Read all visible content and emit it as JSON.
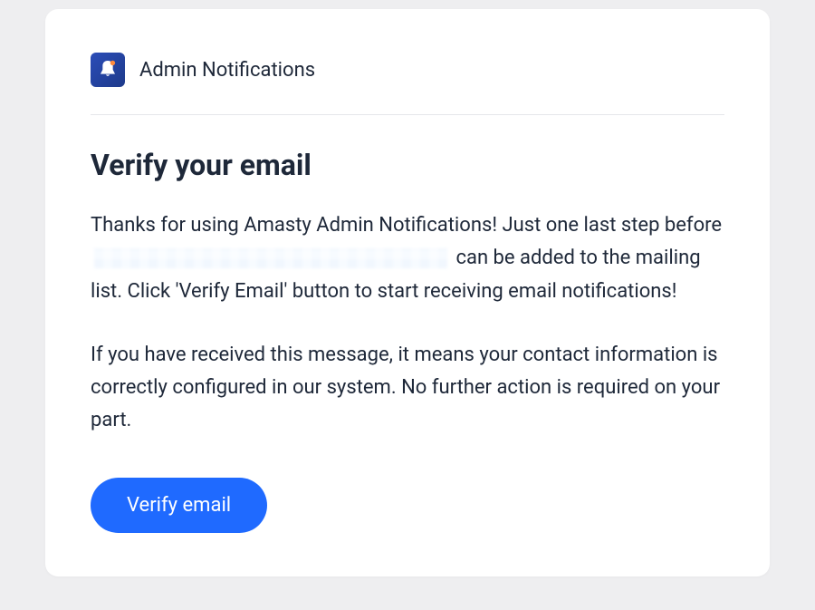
{
  "header": {
    "icon_name": "bell-notification-icon",
    "title": "Admin Notifications"
  },
  "content": {
    "heading": "Verify your email",
    "paragraph1_before": "Thanks for using Amasty Admin Notifications! Just one last step before ",
    "paragraph1_after": " can be added to the mailing list. Click 'Verify Email' button to start receiving email notifications!",
    "paragraph2": "If you have received this message, it means your contact information is correctly configured in our system. No further action is required on your part.",
    "button_label": "Verify email"
  },
  "colors": {
    "primary_button": "#1f6aff",
    "text": "#1e2839",
    "logo_bg": "#1e3a8a"
  }
}
